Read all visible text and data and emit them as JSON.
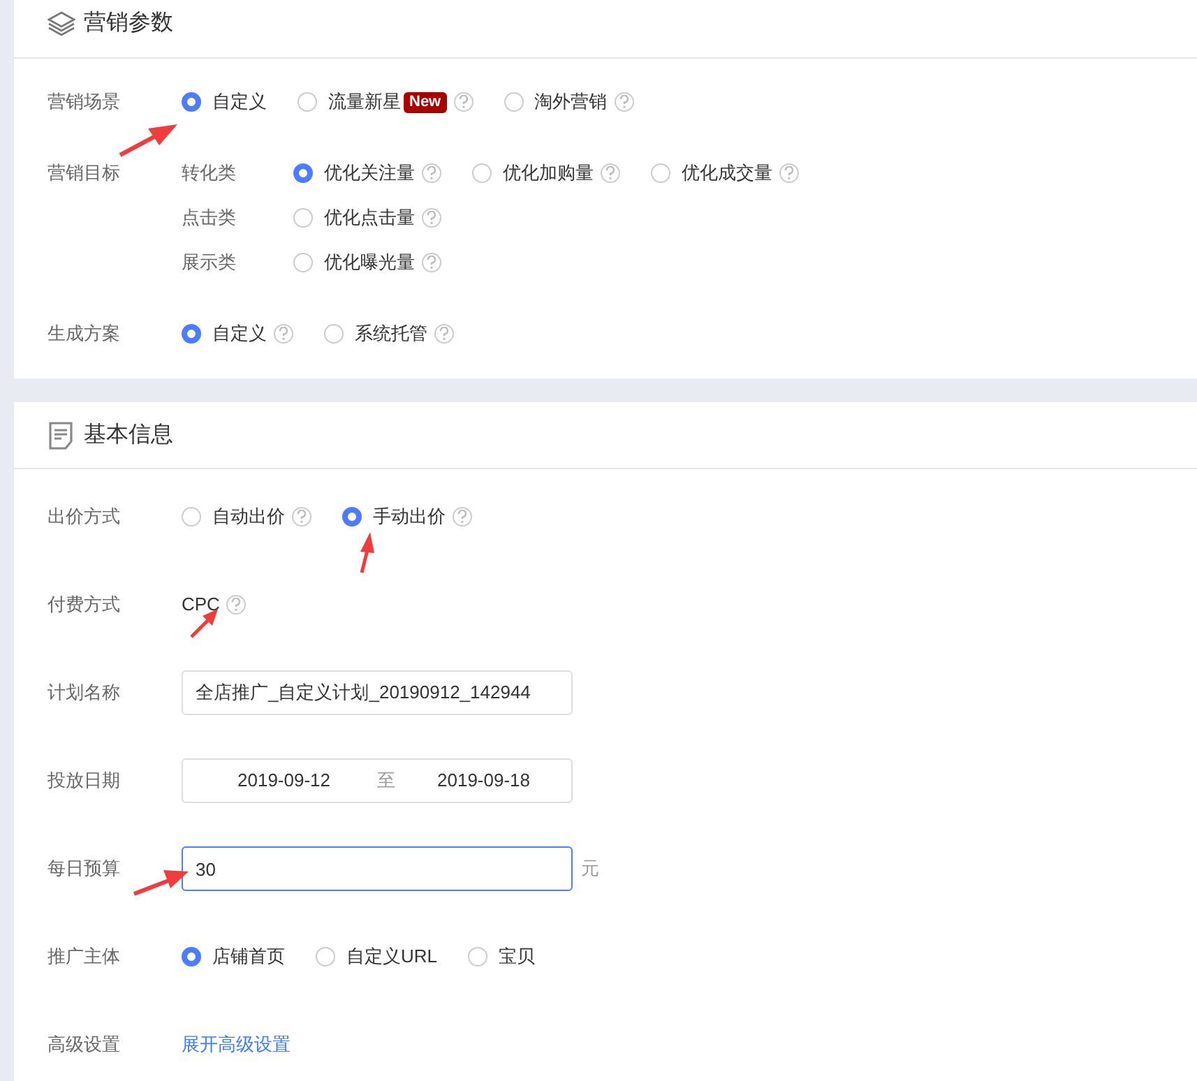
{
  "sections": [
    {
      "title": "营销参数",
      "rows": [
        {
          "kind": "radio",
          "label": "营销场景",
          "options": [
            {
              "label": "自定义",
              "selected": true,
              "help": false
            },
            {
              "label": "流量新星",
              "selected": false,
              "help": true,
              "badge": "New"
            },
            {
              "label": "淘外营销",
              "selected": false,
              "help": true
            }
          ]
        },
        {
          "kind": "radio_groups",
          "label": "营销目标",
          "groups": [
            {
              "category": "转化类",
              "options": [
                {
                  "label": "优化关注量",
                  "selected": true,
                  "help": true
                },
                {
                  "label": "优化加购量",
                  "selected": false,
                  "help": true
                },
                {
                  "label": "优化成交量",
                  "selected": false,
                  "help": true
                }
              ]
            },
            {
              "category": "点击类",
              "options": [
                {
                  "label": "优化点击量",
                  "selected": false,
                  "help": true
                }
              ]
            },
            {
              "category": "展示类",
              "options": [
                {
                  "label": "优化曝光量",
                  "selected": false,
                  "help": true
                }
              ]
            }
          ]
        },
        {
          "kind": "radio",
          "label": "生成方案",
          "options": [
            {
              "label": "自定义",
              "selected": true,
              "help": true
            },
            {
              "label": "系统托管",
              "selected": false,
              "help": true
            }
          ]
        }
      ]
    },
    {
      "title": "基本信息",
      "rows": [
        {
          "kind": "radio",
          "label": "出价方式",
          "options": [
            {
              "label": "自动出价",
              "selected": false,
              "help": true
            },
            {
              "label": "手动出价",
              "selected": true,
              "help": true
            }
          ]
        },
        {
          "kind": "text",
          "label": "付费方式",
          "value": "CPC",
          "help": true
        },
        {
          "kind": "input",
          "label": "计划名称",
          "value": "全店推广_自定义计划_20190912_142944",
          "focused": false
        },
        {
          "kind": "date_range",
          "label": "投放日期",
          "start": "2019-09-12",
          "separator": "至",
          "end": "2019-09-18"
        },
        {
          "kind": "input",
          "label": "每日预算",
          "value": "30",
          "focused": true,
          "suffix": "元"
        },
        {
          "kind": "radio",
          "label": "推广主体",
          "options": [
            {
              "label": "店铺首页",
              "selected": true,
              "help": false
            },
            {
              "label": "自定义URL",
              "selected": false,
              "help": false
            },
            {
              "label": "宝贝",
              "selected": false,
              "help": false
            }
          ]
        },
        {
          "kind": "link",
          "label": "高级设置",
          "text": "展开高级设置"
        }
      ]
    }
  ]
}
